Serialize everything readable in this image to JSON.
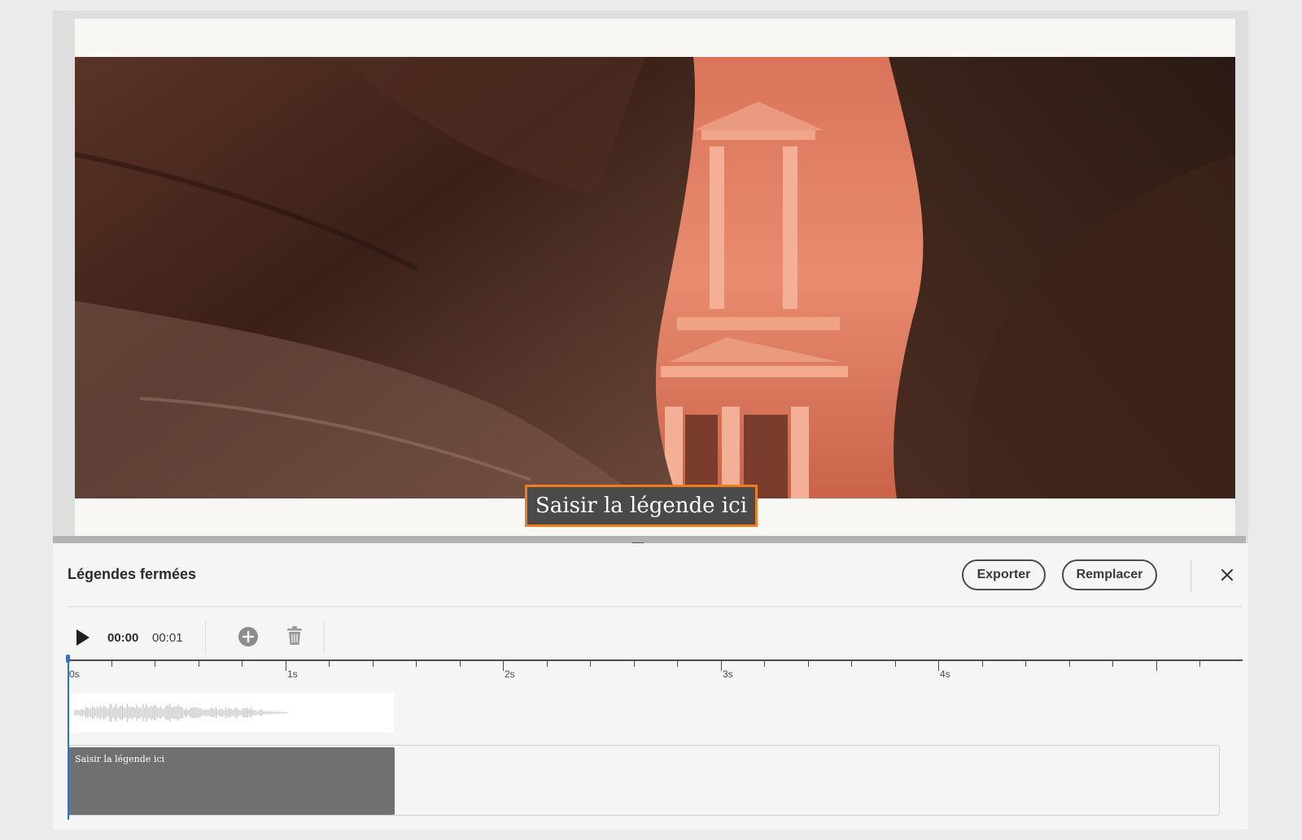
{
  "colors": {
    "accent_orange": "#f07c20",
    "playhead_blue": "#2d6fe0",
    "caption_block": "#707070"
  },
  "slide": {
    "caption_text": "Saisir la légende ici"
  },
  "panel": {
    "title": "Légendes fermées",
    "export_label": "Exporter",
    "replace_label": "Remplacer",
    "close_icon": "close-icon"
  },
  "toolbar": {
    "play_icon": "play-icon",
    "current_time": "00:00",
    "duration": "00:01",
    "add_icon": "add-circle-icon",
    "delete_icon": "trash-icon"
  },
  "timeline": {
    "labels": [
      "0s",
      "1s",
      "2s",
      "3s",
      "4s"
    ],
    "caption_block_text": "Saisir la légende ici"
  }
}
